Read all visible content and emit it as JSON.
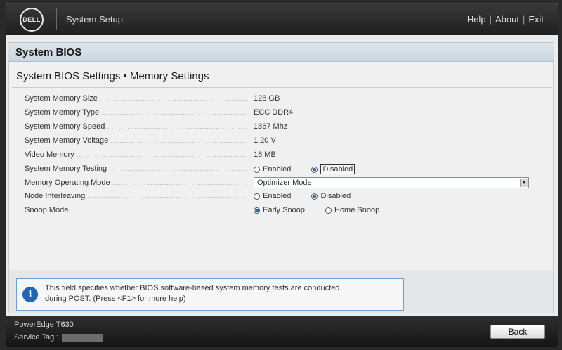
{
  "header": {
    "logo_text": "DELL",
    "app_title": "System Setup",
    "links": [
      "Help",
      "About",
      "Exit"
    ]
  },
  "section": {
    "title": "System BIOS"
  },
  "page": {
    "title": "System BIOS Settings • Memory Settings",
    "settings": [
      {
        "label": "System Memory Size",
        "value": "128 GB"
      },
      {
        "label": "System Memory Type",
        "value": "ECC DDR4"
      },
      {
        "label": "System Memory Speed",
        "value": "1867 Mhz"
      },
      {
        "label": "System Memory Voltage",
        "value": "1.20 V"
      },
      {
        "label": "Video Memory",
        "value": "16 MB"
      },
      {
        "label": "System Memory Testing",
        "options": [
          "Enabled",
          "Disabled"
        ],
        "selected": "Disabled"
      },
      {
        "label": "Memory Operating Mode",
        "value": "Optimizer Mode"
      },
      {
        "label": "Node Interleaving",
        "options": [
          "Enabled",
          "Disabled"
        ],
        "selected": "Disabled"
      },
      {
        "label": "Snoop Mode",
        "options": [
          "Early Snoop",
          "Home Snoop"
        ],
        "selected": "Early Snoop"
      }
    ]
  },
  "help": {
    "icon": "info-icon",
    "text_line1": "This field specifies whether BIOS software-based system memory tests are conducted",
    "text_line2": "during POST. (Press <F1> for more help)"
  },
  "footer": {
    "model": "PowerEdge T630",
    "service_tag_label": "Service Tag :",
    "back_label": "Back"
  },
  "colors": {
    "accent_blue": "#1b5fb8",
    "header_dark": "#1f1f1f",
    "section_bar": "#c9d6e1"
  }
}
